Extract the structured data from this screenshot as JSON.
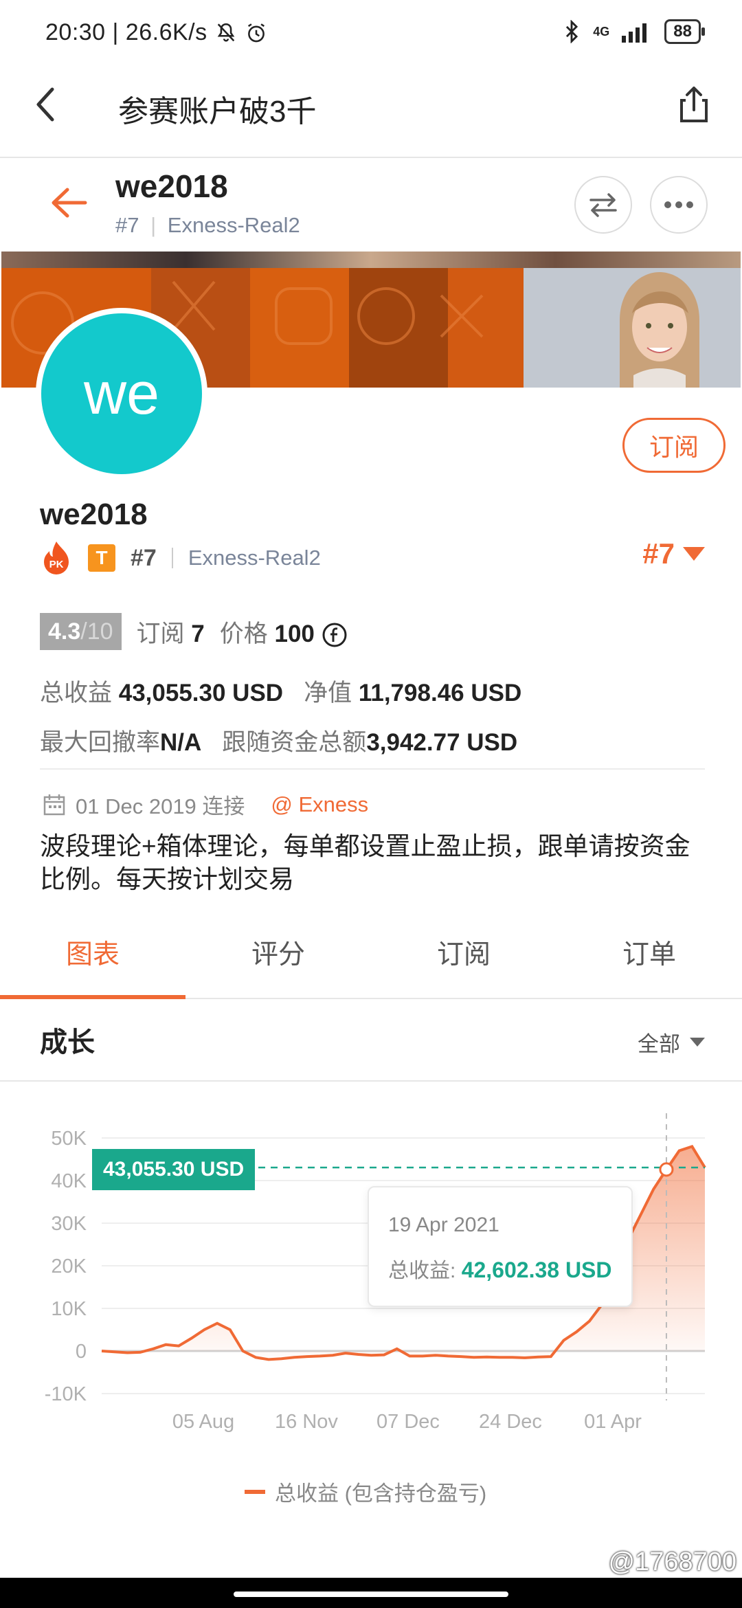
{
  "status_bar": {
    "time_speed": "20:30 | 26.6K/s",
    "network": "4G",
    "battery": "88"
  },
  "nav": {
    "title": "参赛账户破3千"
  },
  "profile_header": {
    "name": "we2018",
    "rank": "#7",
    "account": "Exness-Real2"
  },
  "avatar_text": "we",
  "subscribe_label": "订阅",
  "profile": {
    "name": "we2018",
    "pk_label": "PK",
    "tier_badge": "T",
    "rank": "#7",
    "account": "Exness-Real2",
    "rank_right": "#7"
  },
  "score": {
    "value": "4.3",
    "max": "/10",
    "subs_label": "订阅",
    "subs_value": "7",
    "price_label": "价格",
    "price_value": "100"
  },
  "stats": {
    "total_profit_label": "总收益",
    "total_profit_value": "43,055.30 USD",
    "equity_label": "净值",
    "equity_value": "11,798.46 USD",
    "drawdown_label": "最大回撤率",
    "drawdown_value": "N/A",
    "follow_label": "跟随资金总额",
    "follow_value": "3,942.77 USD"
  },
  "connection": {
    "date": "01 Dec 2019 连接",
    "broker": "@ Exness"
  },
  "description": "波段理论+箱体理论，每单都设置止盈止损，跟单请按资金比例。每天按计划交易",
  "tabs": [
    {
      "label": "图表",
      "active": true
    },
    {
      "label": "评分",
      "active": false
    },
    {
      "label": "订阅",
      "active": false
    },
    {
      "label": "订单",
      "active": false
    }
  ],
  "growth": {
    "title": "成长",
    "filter": "全部"
  },
  "chart_data": {
    "type": "area",
    "title": "",
    "ylim": [
      -10000,
      50000
    ],
    "yticks": [
      "50K",
      "40K",
      "30K",
      "20K",
      "10K",
      "0",
      "-10K"
    ],
    "xticks": [
      "05 Aug",
      "16 Nov",
      "07 Dec",
      "24 Dec",
      "01 Apr"
    ],
    "series": [
      {
        "name": "总收益 (包含持仓盈亏)",
        "values": [
          0,
          -200,
          -400,
          -300,
          500,
          1500,
          1200,
          3000,
          5000,
          6500,
          5000,
          0,
          -1500,
          -2000,
          -1800,
          -1500,
          -1300,
          -1200,
          -1000,
          -500,
          -800,
          -1000,
          -900,
          500,
          -1200,
          -1200,
          -1000,
          -1200,
          -1300,
          -1500,
          -1400,
          -1500,
          -1500,
          -1600,
          -1400,
          -1300,
          2500,
          4500,
          7000,
          11000,
          18000,
          26000,
          32000,
          38000,
          42602,
          47000,
          48000,
          43055
        ]
      }
    ],
    "current_value_label": "43,055.30 USD",
    "tooltip": {
      "date": "19 Apr 2021",
      "label": "总收益:",
      "value": "42,602.38 USD"
    },
    "colors": {
      "line": "#f06a35",
      "tag": "#1aa88c"
    }
  },
  "watermark": "@1768700"
}
